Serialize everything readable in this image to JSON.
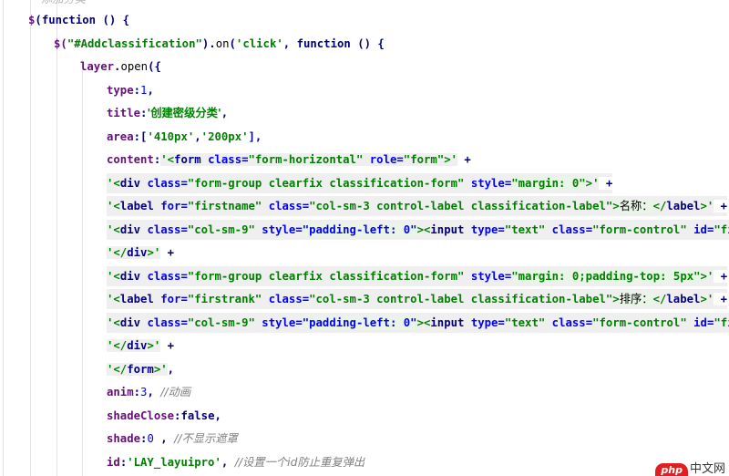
{
  "editor": {
    "top_comment": "添加分类",
    "lines": {
      "l1": {
        "a": "$",
        "b": "(",
        "c": "function",
        "d": " () {"
      },
      "l2": {
        "a": "$(",
        "b": "\"#Addclassification\"",
        "c": ").",
        "d": "on",
        "e": "(",
        "f": "'click'",
        "g": ", ",
        "h": "function",
        "i": " () {"
      },
      "l3": {
        "a": "layer",
        "b": ".",
        "c": "open",
        "d": "({"
      },
      "l4": {
        "a": "type",
        "b": ":",
        "c": "1",
        "d": ","
      },
      "l5": {
        "a": "title",
        "b": ":",
        "c": "'创建密级分类'",
        "d": ","
      },
      "l6": {
        "a": "area",
        "b": ":[",
        "c": "'410px'",
        "d": ",",
        "e": "'200px'",
        "f": "],"
      },
      "l7": {
        "a": "content",
        "b": ":",
        "c": "'<",
        "d": "form ",
        "e": "class=",
        "f": "\"form-horizontal\" ",
        "g": "role=",
        "h": "\"form\"",
        "i": ">'",
        "j": " +"
      },
      "l8": {
        "a": "'<",
        "b": "div ",
        "c": "class=",
        "d": "\"form-group clearfix classification-form\" ",
        "e": "style=",
        "f": "\"margin: 0\"",
        "g": ">'",
        "h": " +"
      },
      "l9": {
        "a": "'<",
        "b": "label ",
        "c": "for=",
        "d": "\"firstname\" ",
        "e": "class=",
        "f": "\"col-sm-3 control-label classification-label\"",
        "g": ">",
        "h": "名称：",
        "i": "</",
        "j": "label",
        "k": ">'",
        "l": " +"
      },
      "l10": {
        "a": "'<",
        "b": "div ",
        "c": "class=",
        "d": "\"col-sm-9\" ",
        "e": "style=",
        "f": "\"padding-left: 0\"",
        "g": "><",
        "h": "input ",
        "i": "type=",
        "j": "\"text\" ",
        "k": "class=",
        "l": "\"form-control\" ",
        "m": "id=",
        "n": "\"fir"
      },
      "l11": {
        "a": "'</",
        "b": "div",
        "c": ">'",
        "d": " +"
      },
      "l12": {
        "a": "'<",
        "b": "div ",
        "c": "class=",
        "d": "\"form-group clearfix classification-form\" ",
        "e": "style=",
        "f": "\"margin: 0;padding-top: 5px\"",
        "g": ">'",
        "h": " +"
      },
      "l13": {
        "a": "'<",
        "b": "label ",
        "c": "for=",
        "d": "\"firstrank\" ",
        "e": "class=",
        "f": "\"col-sm-3 control-label classification-label\"",
        "g": ">",
        "h": "排序：",
        "i": "</",
        "j": "label",
        "k": ">'",
        "l": " +"
      },
      "l14": {
        "a": "'<",
        "b": "div ",
        "c": "class=",
        "d": "\"col-sm-9\" ",
        "e": "style=",
        "f": "\"padding-left: 0\"",
        "g": "><",
        "h": "input ",
        "i": "type=",
        "j": "\"text\" ",
        "k": "class=",
        "l": "\"form-control\" ",
        "m": "id=",
        "n": "\"fir"
      },
      "l15": {
        "a": "'</",
        "b": "div",
        "c": ">'",
        "d": " +"
      },
      "l16": {
        "a": "'</",
        "b": "form",
        "c": ">'",
        "d": ","
      },
      "l17": {
        "a": "anim",
        "b": ":",
        "c": "3",
        "d": ", ",
        "e": "//动画"
      },
      "l18": {
        "a": "shadeClose",
        "b": ":",
        "c": "false",
        "d": ","
      },
      "l19": {
        "a": "shade",
        "b": ":",
        "c": "0",
        "d": " , ",
        "e": "//不显示遮罩"
      },
      "l20": {
        "a": "id",
        "b": ":",
        "c": "'LAY_layuipro'",
        "d": ", ",
        "e": "//设置一个id防止重复弹出"
      }
    }
  },
  "watermark": {
    "badge": "php",
    "text": "中文网"
  }
}
